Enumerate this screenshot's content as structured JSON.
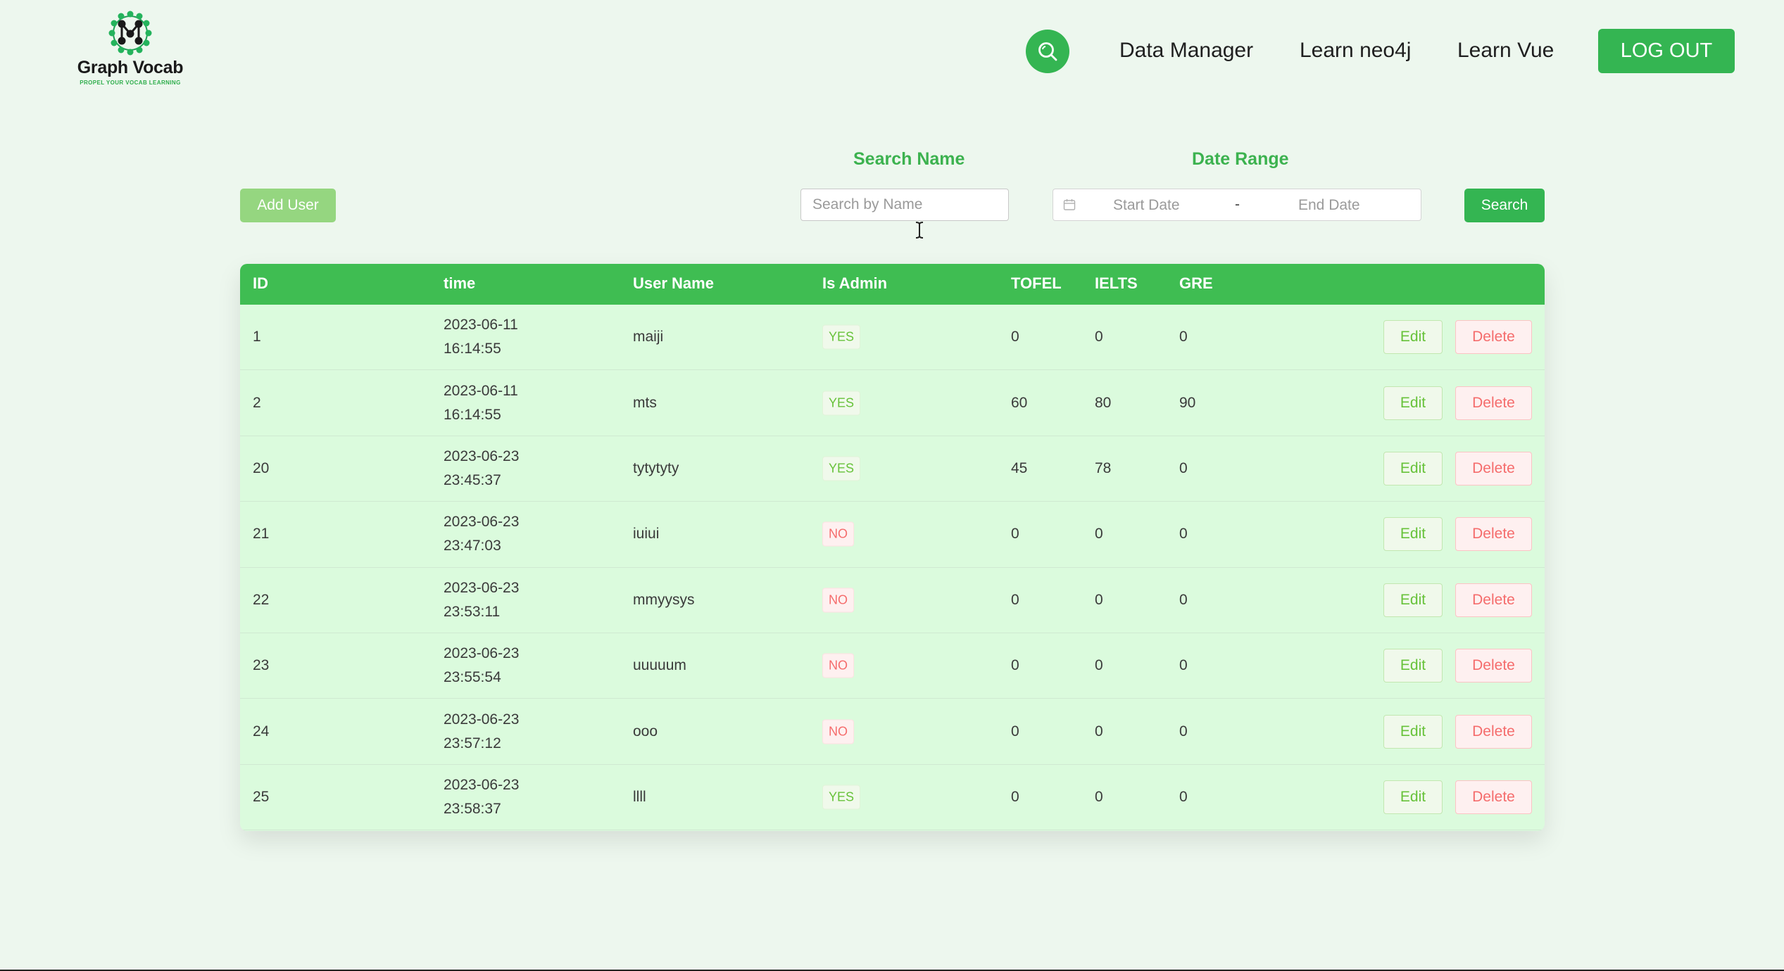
{
  "header": {
    "logo_title": "Graph Vocab",
    "logo_tagline": "PROPEL YOUR VOCAB LEARNING",
    "nav": [
      "Data Manager",
      "Learn neo4j",
      "Learn Vue"
    ],
    "logout_label": "LOG OUT",
    "search_icon": "search-icon"
  },
  "filters": {
    "add_user_label": "Add User",
    "search_name_label": "Search Name",
    "search_name_placeholder": "Search by Name",
    "date_range_label": "Date Range",
    "start_date_placeholder": "Start Date",
    "date_separator": "-",
    "end_date_placeholder": "End Date",
    "search_label": "Search"
  },
  "table": {
    "columns": [
      "ID",
      "time",
      "User Name",
      "Is Admin",
      "TOFEL",
      "IELTS",
      "GRE"
    ],
    "edit_label": "Edit",
    "delete_label": "Delete",
    "rows": [
      {
        "id": "1",
        "date": "2023-06-11",
        "clock": "16:14:55",
        "name": "maiji",
        "admin": "YES",
        "tofel": "0",
        "ielts": "0",
        "gre": "0"
      },
      {
        "id": "2",
        "date": "2023-06-11",
        "clock": "16:14:55",
        "name": "mts",
        "admin": "YES",
        "tofel": "60",
        "ielts": "80",
        "gre": "90"
      },
      {
        "id": "20",
        "date": "2023-06-23",
        "clock": "23:45:37",
        "name": "tytytyty",
        "admin": "YES",
        "tofel": "45",
        "ielts": "78",
        "gre": "0"
      },
      {
        "id": "21",
        "date": "2023-06-23",
        "clock": "23:47:03",
        "name": "iuiui",
        "admin": "NO",
        "tofel": "0",
        "ielts": "0",
        "gre": "0"
      },
      {
        "id": "22",
        "date": "2023-06-23",
        "clock": "23:53:11",
        "name": "mmyysys",
        "admin": "NO",
        "tofel": "0",
        "ielts": "0",
        "gre": "0"
      },
      {
        "id": "23",
        "date": "2023-06-23",
        "clock": "23:55:54",
        "name": "uuuuum",
        "admin": "NO",
        "tofel": "0",
        "ielts": "0",
        "gre": "0"
      },
      {
        "id": "24",
        "date": "2023-06-23",
        "clock": "23:57:12",
        "name": "ooo",
        "admin": "NO",
        "tofel": "0",
        "ielts": "0",
        "gre": "0"
      },
      {
        "id": "25",
        "date": "2023-06-23",
        "clock": "23:58:37",
        "name": "llll",
        "admin": "YES",
        "tofel": "0",
        "ielts": "0",
        "gre": "0"
      }
    ]
  },
  "colors": {
    "background": "#edf7ee",
    "primary": "#34b552",
    "table_header": "#3fbd52",
    "table_body": "#dbfbdd",
    "add_user": "#95d680"
  }
}
